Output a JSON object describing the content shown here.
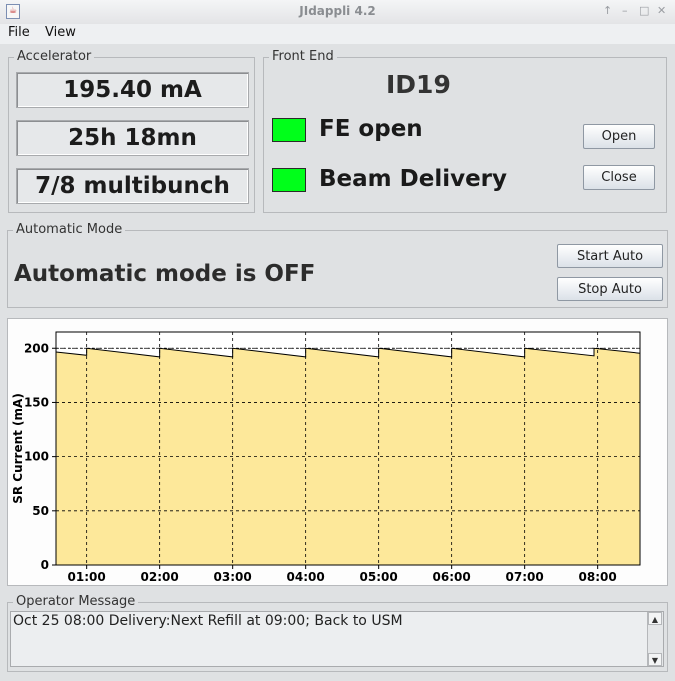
{
  "window": {
    "title": "JIdappli  4.2",
    "buttons": {
      "up": "↑",
      "minimize": "–",
      "maximize": "□",
      "close": "✕"
    },
    "app_icon": "java-cup-icon"
  },
  "menu": {
    "items": [
      "File",
      "View"
    ]
  },
  "accelerator": {
    "title": "Accelerator",
    "current": "195.40 mA",
    "lifetime": "25h 18mn",
    "mode": "7/8 multibunch"
  },
  "front_end": {
    "title": "Front End",
    "beamline": "ID19",
    "status1": "FE open",
    "status2": "Beam Delivery",
    "status_color": "#00ff1a",
    "open_label": "Open",
    "close_label": "Close"
  },
  "automatic_mode": {
    "title": "Automatic Mode",
    "status": "Automatic mode is OFF",
    "start_label": "Start Auto",
    "stop_label": "Stop Auto"
  },
  "chart_data": {
    "type": "area",
    "ylabel": "SR Current (mA)",
    "xlabel": "",
    "ylim": [
      0,
      215
    ],
    "yticks": [
      0,
      50,
      100,
      150,
      200
    ],
    "xticks": [
      "01:00",
      "02:00",
      "03:00",
      "04:00",
      "05:00",
      "06:00",
      "07:00",
      "08:00"
    ],
    "x_range_hours": [
      0.58,
      8.58
    ],
    "reference_level": 200,
    "fill_color": "#fde89a",
    "line_color": "#000000",
    "grid": true,
    "series": [
      {
        "x": [
          0.58,
          1.0,
          1.0,
          2.0,
          2.0,
          3.0,
          3.0,
          4.0,
          4.0,
          5.0,
          5.0,
          6.0,
          6.0,
          7.0,
          7.0,
          7.95,
          7.95,
          8.58
        ],
        "y": [
          196.5,
          193.5,
          200,
          192,
          200,
          192,
          200,
          192,
          200,
          192,
          200,
          192,
          200,
          192,
          200,
          193,
          200,
          195.4
        ]
      }
    ]
  },
  "operator_message": {
    "title": "Operator Message",
    "text": "Oct 25 08:00 Delivery:Next Refill at 09:00; Back to USM"
  }
}
